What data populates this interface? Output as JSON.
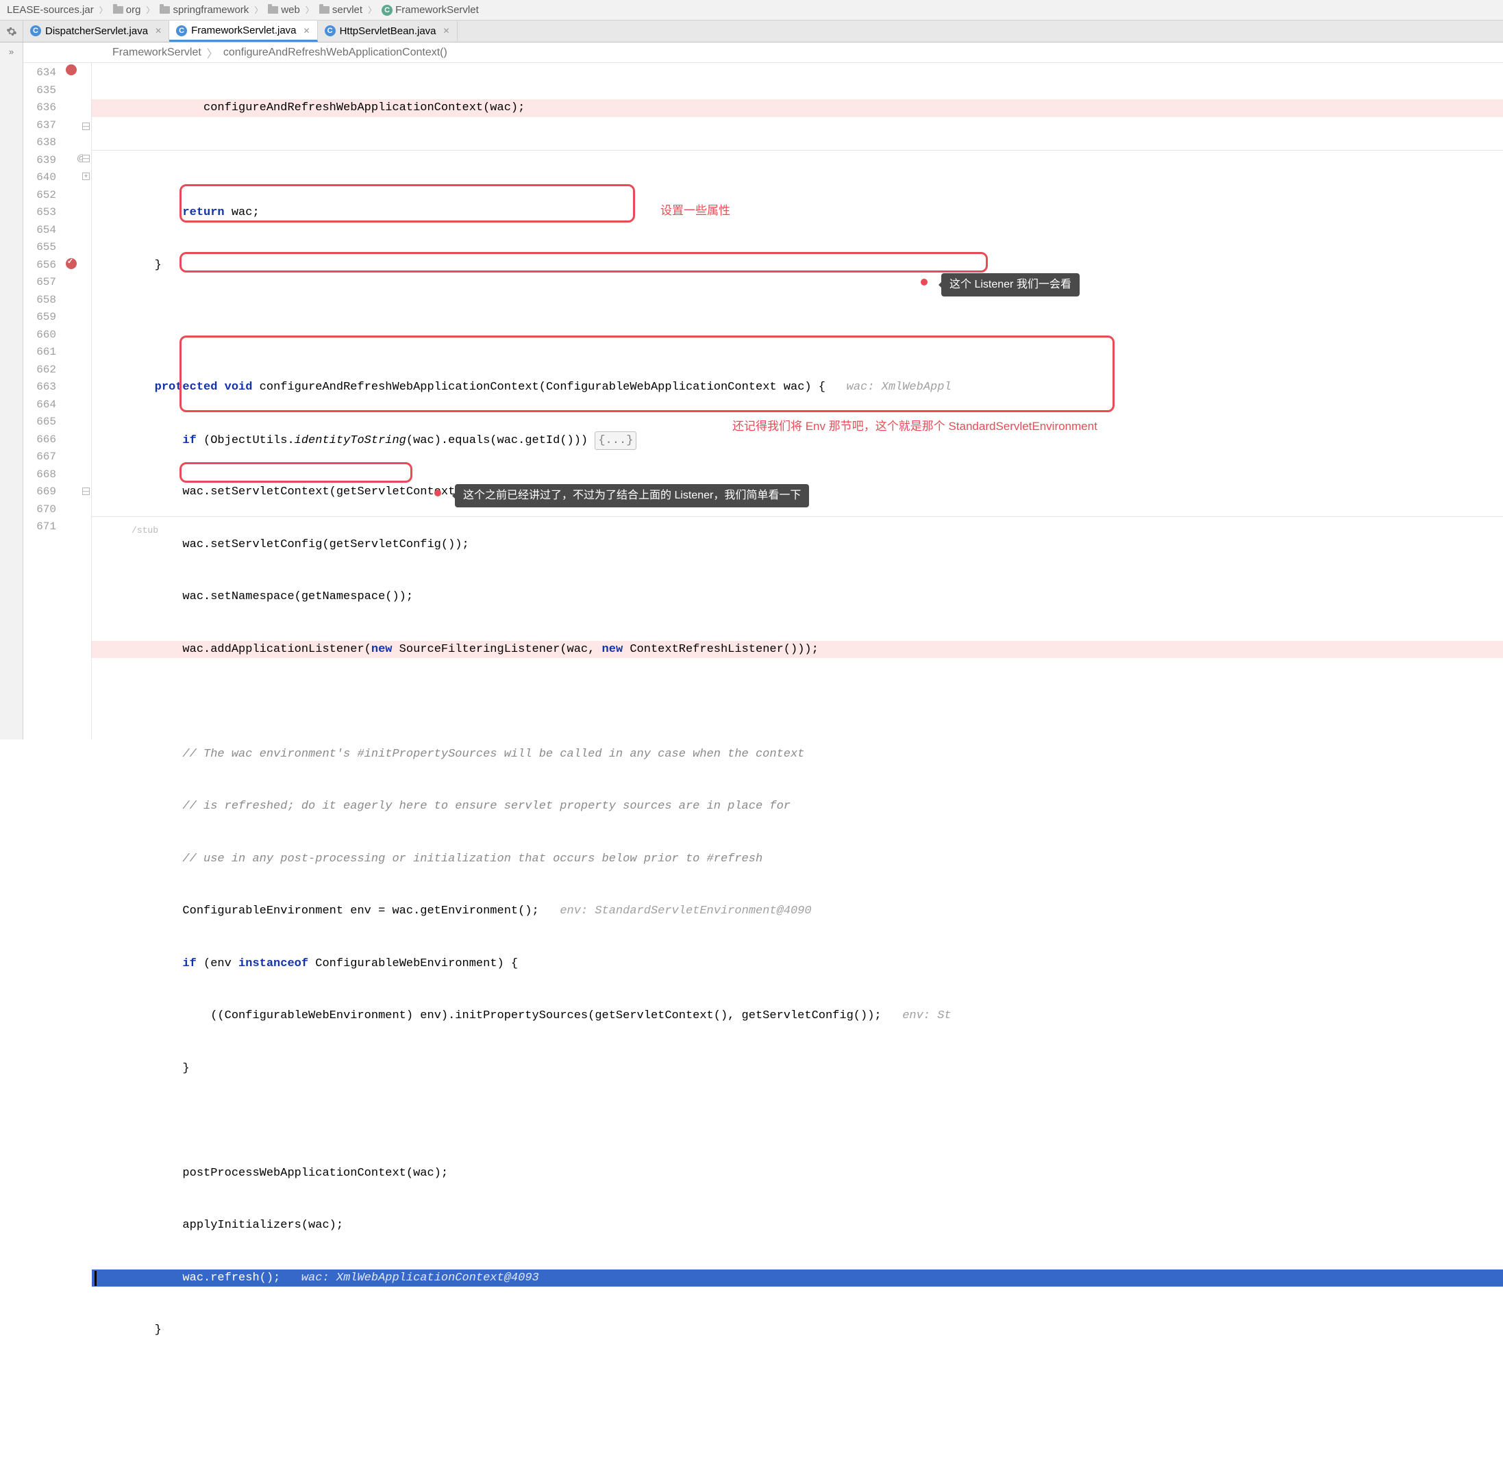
{
  "breadcrumbs": {
    "jar": "LEASE-sources.jar",
    "org": "org",
    "sf": "springframework",
    "web": "web",
    "servlet": "servlet",
    "cls": "FrameworkServlet"
  },
  "tabs": {
    "t0": "DispatcherServlet.java",
    "t1": "FrameworkServlet.java",
    "t2": "HttpServletBean.java"
  },
  "crumb": {
    "cls": "FrameworkServlet",
    "mtd": "configureAndRefreshWebApplicationContext()"
  },
  "lineNumbers": [
    "634",
    "635",
    "636",
    "637",
    "638",
    "639",
    "640",
    "652",
    "653",
    "654",
    "655",
    "656",
    "657",
    "658",
    "659",
    "660",
    "661",
    "662",
    "663",
    "664",
    "665",
    "666",
    "667",
    "668",
    "669",
    "670",
    "671"
  ],
  "gutterMarks": {
    "override": "@"
  },
  "code": {
    "l634": "configureAndRefreshWebApplicationContext(wac);",
    "l636_kw": "return",
    "l636_rest": " wac;",
    "l637": "}",
    "l639_kw1": "protected",
    "l639_kw2": "void",
    "l639_sig": " configureAndRefreshWebApplicationContext(ConfigurableWebApplicationContext wac) {",
    "l639_hint": "   wac: XmlWebAppl",
    "l640_kw": "if",
    "l640_a": " (ObjectUtils.",
    "l640_fn": "identityToString",
    "l640_b": "(wac).equals(wac.getId())) ",
    "l640_fold": "{...}",
    "l653": "wac.setServletContext(getServletContext());",
    "l654": "wac.setServletConfig(getServletConfig());",
    "l655": "wac.setNamespace(getNamespace());",
    "l656_a": "wac.addApplicationListener(",
    "l656_kw1": "new",
    "l656_b": " SourceFilteringListener(wac, ",
    "l656_kw2": "new",
    "l656_c": " ContextRefreshListener()));",
    "l658": "// The wac environment's #initPropertySources will be called in any case when the context",
    "l659": "// is refreshed; do it eagerly here to ensure servlet property sources are in place for",
    "l660": "// use in any post-processing or initialization that occurs below prior to #refresh",
    "l661_a": "ConfigurableEnvironment env = wac.getEnvironment();",
    "l661_hint": "   env: StandardServletEnvironment@4090",
    "l662_kw1": "if",
    "l662_a": " (env ",
    "l662_kw2": "instanceof",
    "l662_b": " ConfigurableWebEnvironment) {",
    "l663": "((ConfigurableWebEnvironment) env).initPropertySources(getServletContext(), getServletConfig());",
    "l663_hint": "   env: St",
    "l664": "}",
    "l666": "postProcessWebApplicationContext(wac);",
    "l667": "applyInitializers(wac);",
    "l668": "wac.refresh();",
    "l668_hint": "wac: XmlWebApplicationContext@4093",
    "l669": "}",
    "l671_stub": "/stub"
  },
  "annotations": {
    "a1": "设置一些属性",
    "a2": "这个 Listener 我们一会看",
    "a3": "还记得我们将 Env 那节吧，这个就是那个 StandardServletEnvironment",
    "a4": "这个之前已经讲过了，不过为了结合上面的 Listener，我们简单看一下"
  }
}
